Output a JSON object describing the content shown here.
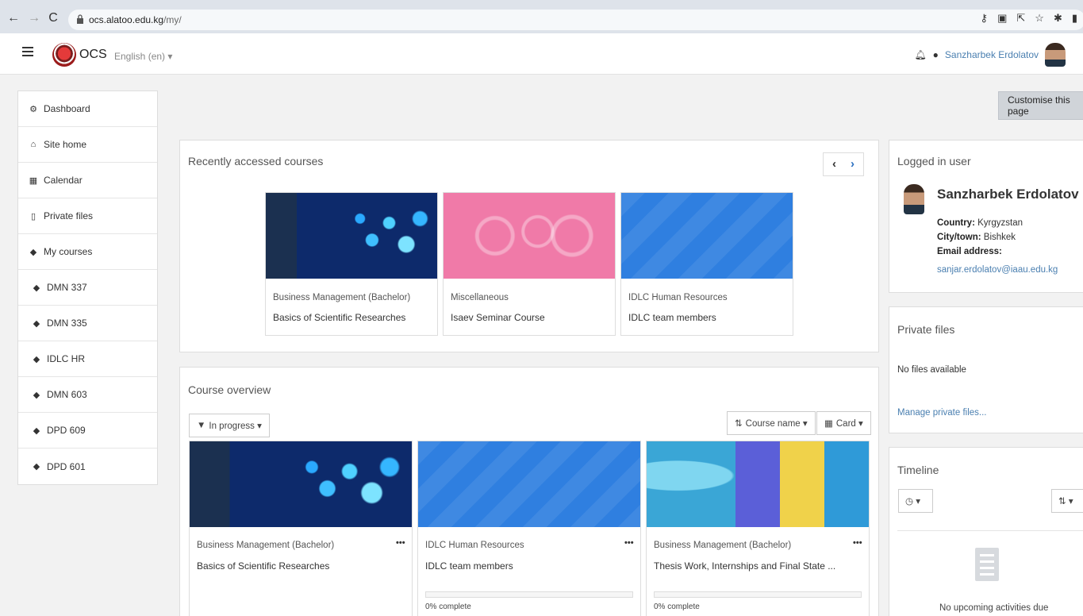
{
  "browser": {
    "url_host": "ocs.alatoo.edu.kg",
    "url_path": "/my/"
  },
  "navbar": {
    "brand": "OCS",
    "language": "English (en) ▾",
    "user_name": "Sanzharbek Erdolatov"
  },
  "sidebar": {
    "items": [
      {
        "label": "Dashboard",
        "icon": "dashboard-icon"
      },
      {
        "label": "Site home",
        "icon": "home-icon"
      },
      {
        "label": "Calendar",
        "icon": "calendar-icon"
      },
      {
        "label": "Private files",
        "icon": "file-icon"
      },
      {
        "label": "My courses",
        "icon": "graduation-cap-icon"
      },
      {
        "label": "DMN 337",
        "icon": "graduation-cap-icon"
      },
      {
        "label": "DMN 335",
        "icon": "graduation-cap-icon"
      },
      {
        "label": "IDLC HR",
        "icon": "graduation-cap-icon"
      },
      {
        "label": "DMN 603",
        "icon": "graduation-cap-icon"
      },
      {
        "label": "DPD 609",
        "icon": "graduation-cap-icon"
      },
      {
        "label": "DPD 601",
        "icon": "graduation-cap-icon"
      }
    ]
  },
  "customise_label": "Customise this page",
  "recent": {
    "title": "Recently accessed courses",
    "courses": [
      {
        "category": "Business Management (Bachelor)",
        "name": "Basics of Scientific Researches"
      },
      {
        "category": "Miscellaneous",
        "name": "Isaev Seminar Course"
      },
      {
        "category": "IDLC Human Resources",
        "name": "IDLC team members"
      }
    ]
  },
  "overview": {
    "title": "Course overview",
    "filter_label": "In progress ▾",
    "sort_label": "Course name ▾",
    "view_label": "Card ▾",
    "courses": [
      {
        "category": "Business Management (Bachelor)",
        "name": "Basics of Scientific Researches",
        "progress_label": ""
      },
      {
        "category": "IDLC Human Resources",
        "name": "IDLC team members",
        "progress_label": "0% complete"
      },
      {
        "category": "Business Management (Bachelor)",
        "name": "Thesis Work, Internships and Final State ...",
        "progress_label": "0% complete"
      }
    ],
    "more_label": "•••"
  },
  "logged_in": {
    "title": "Logged in user",
    "name": "Sanzharbek Erdolatov",
    "country_label": "Country:",
    "country": "Kyrgyzstan",
    "city_label": "City/town:",
    "city": "Bishkek",
    "email_label": "Email address:",
    "email": "sanjar.erdolatov@iaau.edu.kg"
  },
  "private_files": {
    "title": "Private files",
    "empty": "No files available",
    "manage_link": "Manage private files..."
  },
  "timeline": {
    "title": "Timeline",
    "empty": "No upcoming activities due"
  }
}
